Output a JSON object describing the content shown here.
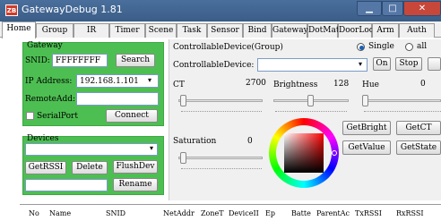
{
  "window": {
    "title": "GatewayDebug 1.81",
    "app_icon_text": "ZB"
  },
  "tabs": [
    "Home",
    "Group",
    "IR",
    "Timer",
    "Scene",
    "Task",
    "Sensor",
    "Bind",
    "Gateway",
    "DotMatx",
    "DoorLoc",
    "Arm",
    "Auth"
  ],
  "gateway": {
    "section_label": "Gateway",
    "snid_label": "SNID:",
    "snid_value": "FFFFFFFF",
    "search_button": "Search",
    "ip_label": "IP Address:",
    "ip_value": "192.168.1.101",
    "remote_label": "RemoteAdd:",
    "serialport_label": "SerialPort",
    "connect_button": "Connect"
  },
  "devices": {
    "section_label": "Devices",
    "getrssi_button": "GetRSSI",
    "delete_button": "Delete",
    "flushdev_button": "FlushDev",
    "rename_button": "Rename"
  },
  "controllable": {
    "group_label": "ControllableDevice(Group)",
    "single_label": "Single",
    "all_label": "all",
    "device_label": "ControllableDevice:",
    "on_button": "On",
    "stop_button": "Stop",
    "ct_label": "CT",
    "ct_value": "2700",
    "brightness_label": "Brightness",
    "brightness_value": "128",
    "hue_label": "Hue",
    "hue_value": "0",
    "saturation_label": "Saturation",
    "saturation_value": "0",
    "getbright_button": "GetBright",
    "getct_button": "GetCT",
    "getvalue_button": "GetValue",
    "getstate_button": "GetState"
  },
  "grid": {
    "columns": [
      "No",
      "Name",
      "SNID",
      "NetAddr",
      "ZoneT",
      "DeviceII",
      "Ep",
      "Batte",
      "ParentAc",
      "TxRSSI",
      "RxRSSI"
    ]
  },
  "colors": {
    "panel_green": "#4dbf52",
    "title_blue": "#3b5d88",
    "close_red": "#c7473a"
  }
}
